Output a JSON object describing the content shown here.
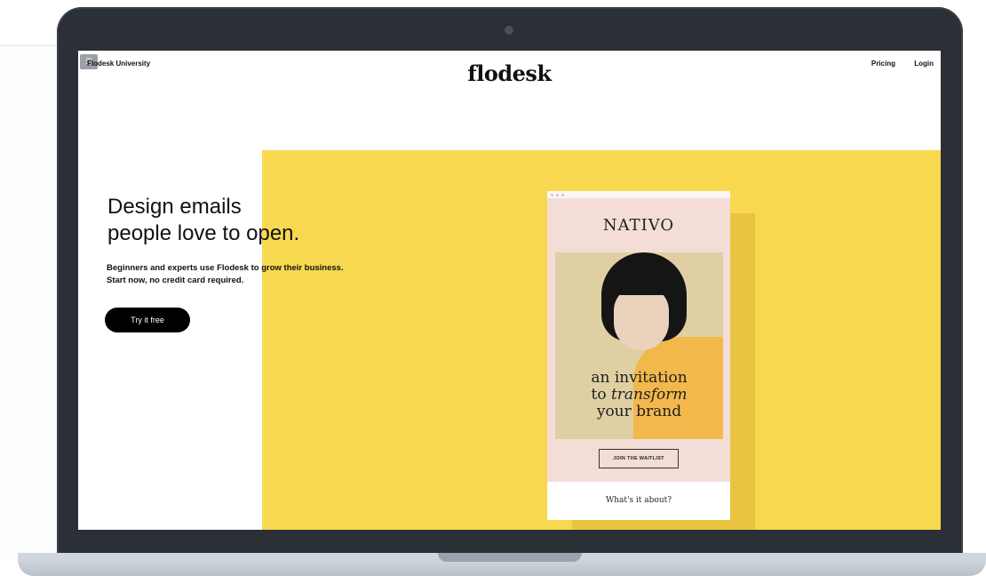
{
  "nav": {
    "left_label": "Flodesk University",
    "logo": "flodesk",
    "pricing": "Pricing",
    "login": "Login"
  },
  "hero": {
    "headline_line1": "Design emails",
    "headline_line2": "people love to open.",
    "subtext": "Beginners and experts use Flodesk to grow their business. Start now, no credit card required.",
    "cta": "Try it free"
  },
  "email_card": {
    "brand": "NATIVO",
    "tagline_line1": "an invitation",
    "tagline_line2_prefix": "to ",
    "tagline_line2_italic": "transform",
    "tagline_line3": "your brand",
    "button": "JOIN THE WAITLIST",
    "footer_text": "What's it about?"
  },
  "colors": {
    "accent_yellow": "#f7d84f",
    "card_pink": "#f3ddd6",
    "cta_black": "#000000",
    "laptop_frame": "#2b3036"
  }
}
